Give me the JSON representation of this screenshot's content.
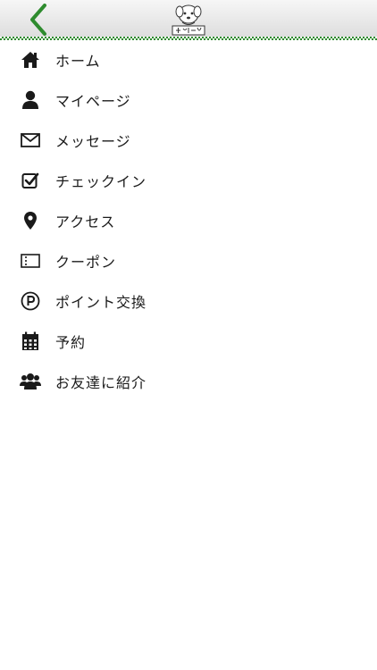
{
  "header": {
    "back_icon": "chevron-left-icon",
    "logo_icon": "dog-mascot-logo"
  },
  "colors": {
    "accent_green": "#2e8b2e",
    "icon_black": "#1a1a1a",
    "header_gradient_top": "#f6f6f6",
    "header_gradient_bottom": "#dcdcdc"
  },
  "menu": {
    "items": [
      {
        "label": "ホーム",
        "icon": "home-icon"
      },
      {
        "label": "マイページ",
        "icon": "user-icon"
      },
      {
        "label": "メッセージ",
        "icon": "envelope-icon"
      },
      {
        "label": "チェックイン",
        "icon": "checkbox-icon"
      },
      {
        "label": "アクセス",
        "icon": "map-pin-icon"
      },
      {
        "label": "クーポン",
        "icon": "coupon-ticket-icon"
      },
      {
        "label": "ポイント交換",
        "icon": "point-p-icon"
      },
      {
        "label": "予約",
        "icon": "calendar-icon"
      },
      {
        "label": "お友達に紹介",
        "icon": "users-icon"
      }
    ]
  }
}
